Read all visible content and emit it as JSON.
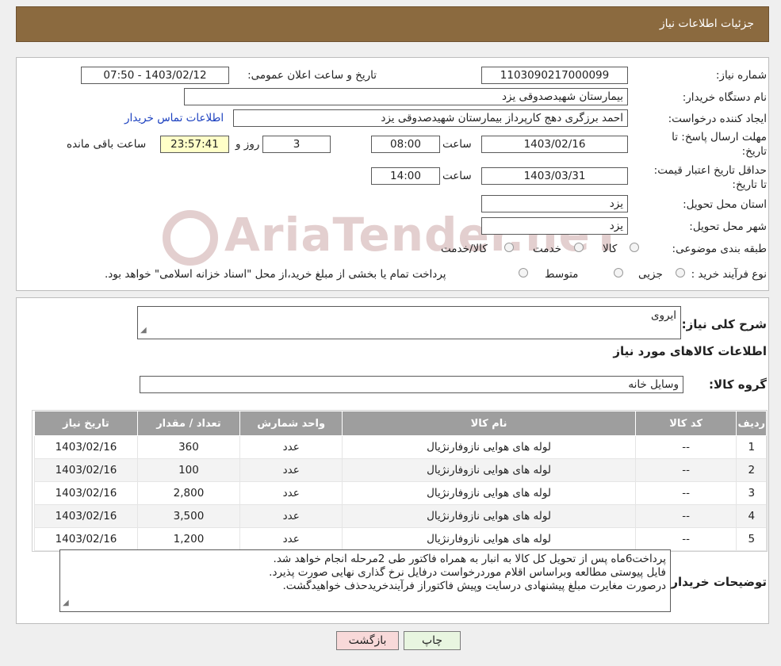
{
  "header": {
    "title": "جزئیات اطلاعات نیاز"
  },
  "form": {
    "need_number_label": "شماره نیاز:",
    "need_number": "1103090217000099",
    "announce_label": "تاریخ و ساعت اعلان عمومی:",
    "announce_value": "1403/02/12 - 07:50",
    "buyer_org_label": "نام دستگاه خریدار:",
    "buyer_org": "بیمارستان شهیدصدوقی یزد",
    "creator_label": "ایجاد کننده درخواست:",
    "creator": "احمد برزگری دهج کارپرداز بیمارستان شهیدصدوقی یزد",
    "contact_link": "اطلاعات تماس خریدار",
    "deadline_label": "مهلت ارسال پاسخ: تا تاریخ:",
    "deadline_date": "1403/02/16",
    "time_label": "ساعت",
    "deadline_time": "08:00",
    "days_value": "3",
    "days_label": "روز و",
    "remaining_time": "23:57:41",
    "remaining_label": "ساعت باقی مانده",
    "validity_label": "حداقل تاریخ اعتبار قیمت: تا تاریخ:",
    "validity_date": "1403/03/31",
    "validity_time": "14:00",
    "province_label": "استان محل تحویل:",
    "province": "یزد",
    "city_label": "شهر محل تحویل:",
    "city": "یزد",
    "category_label": "طبقه بندی موضوعی:",
    "category_options": [
      "کالا",
      "خدمت",
      "کالا/خدمت"
    ],
    "process_label": "نوع فرآیند خرید :",
    "process_options": [
      "جزیی",
      "متوسط"
    ],
    "process_note": "پرداخت تمام یا بخشی از مبلغ خرید،از محل \"اسناد خزانه اسلامی\" خواهد بود."
  },
  "watermark": {
    "text": "AriaTender.neT"
  },
  "details": {
    "summary_label": "شرح کلی نیاز:",
    "summary_value": "ایروی",
    "goods_info_title": "اطلاعات کالاهای مورد نیاز",
    "group_label": "گروه کالا:",
    "group_value": "وسایل خانه"
  },
  "table": {
    "headers": [
      "ردیف",
      "کد کالا",
      "نام کالا",
      "واحد شمارش",
      "تعداد / مقدار",
      "تاریخ نیاز"
    ],
    "rows": [
      [
        "1",
        "--",
        "لوله های هوایی نازوفارنژیال",
        "عدد",
        "360",
        "1403/02/16"
      ],
      [
        "2",
        "--",
        "لوله های هوایی نازوفارنژیال",
        "عدد",
        "100",
        "1403/02/16"
      ],
      [
        "3",
        "--",
        "لوله های هوایی نازوفارنژیال",
        "عدد",
        "2,800",
        "1403/02/16"
      ],
      [
        "4",
        "--",
        "لوله های هوایی نازوفارنژیال",
        "عدد",
        "3,500",
        "1403/02/16"
      ],
      [
        "5",
        "--",
        "لوله های هوایی نازوفارنژیال",
        "عدد",
        "1,200",
        "1403/02/16"
      ]
    ]
  },
  "buyer_notes": {
    "label": "توضیحات خریدار:",
    "lines": [
      "پرداخت6ماه پس از تحویل کل کالا به انبار به همراه فاکتور طی 2مرحله انجام خواهد شد.",
      "فایل پیوستی مطالعه وبراساس اقلام موردرخواست درفایل نرخ گذاری نهایی  صورت پذیرد.",
      "درصورت مغایرت مبلغ پیشنهادی درسایت وپیش فاکتوراز فرآیندخریدحذف خواهیدگشت."
    ]
  },
  "buttons": {
    "print": "چاپ",
    "back": "بازگشت"
  }
}
